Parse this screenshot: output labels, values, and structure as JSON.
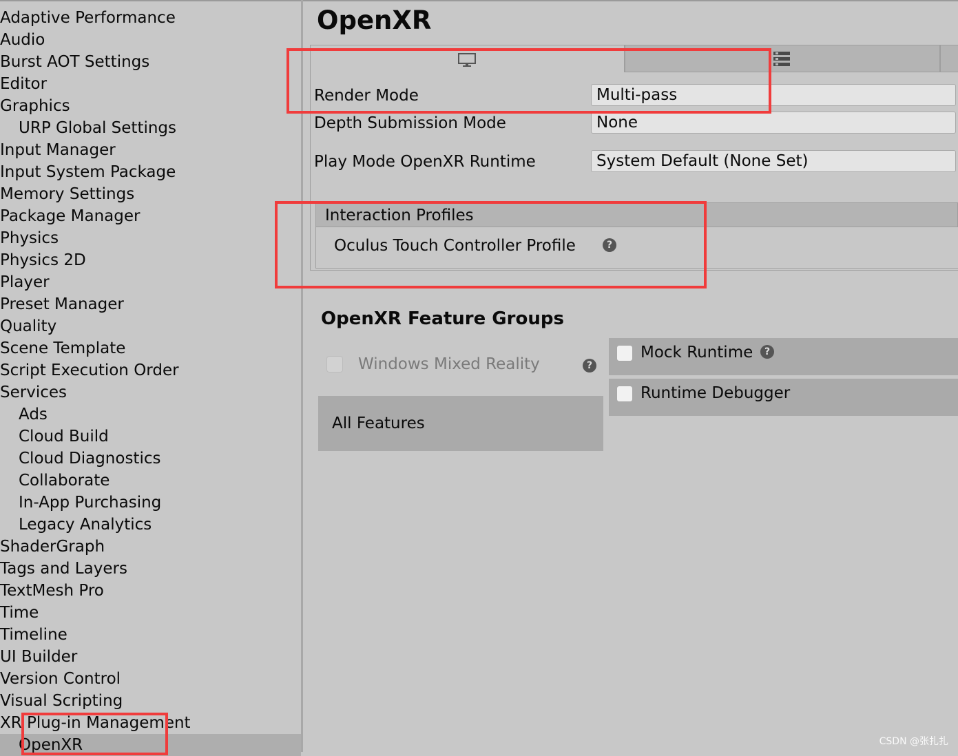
{
  "sidebar": {
    "items": [
      {
        "label": "Adaptive Performance"
      },
      {
        "label": "Audio"
      },
      {
        "label": "Burst AOT Settings"
      },
      {
        "label": "Editor"
      },
      {
        "label": "Graphics"
      },
      {
        "label": "URP Global Settings"
      },
      {
        "label": "Input Manager"
      },
      {
        "label": "Input System Package"
      },
      {
        "label": "Memory Settings"
      },
      {
        "label": "Package Manager"
      },
      {
        "label": "Physics"
      },
      {
        "label": "Physics 2D"
      },
      {
        "label": "Player"
      },
      {
        "label": "Preset Manager"
      },
      {
        "label": "Quality"
      },
      {
        "label": "Scene Template"
      },
      {
        "label": "Script Execution Order"
      },
      {
        "label": "Services"
      },
      {
        "label": "Ads"
      },
      {
        "label": "Cloud Build"
      },
      {
        "label": "Cloud Diagnostics"
      },
      {
        "label": "Collaborate"
      },
      {
        "label": "In-App Purchasing"
      },
      {
        "label": "Legacy Analytics"
      },
      {
        "label": "ShaderGraph"
      },
      {
        "label": "Tags and Layers"
      },
      {
        "label": "TextMesh Pro"
      },
      {
        "label": "Time"
      },
      {
        "label": "Timeline"
      },
      {
        "label": "UI Builder"
      },
      {
        "label": "Version Control"
      },
      {
        "label": "Visual Scripting"
      },
      {
        "label": "XR Plug-in Management"
      },
      {
        "label": "OpenXR",
        "selected": true
      }
    ]
  },
  "main": {
    "title": "OpenXR",
    "tabs": [
      {
        "icon": "monitor-icon",
        "active": true
      },
      {
        "icon": "android-icon",
        "active": false
      }
    ],
    "render_mode": {
      "label": "Render Mode",
      "value": "Multi-pass"
    },
    "depth_submission": {
      "label": "Depth Submission Mode",
      "value": "None"
    },
    "play_mode_runtime": {
      "label": "Play Mode OpenXR Runtime",
      "value": "System Default (None Set)"
    },
    "interaction_profiles": {
      "header": "Interaction Profiles",
      "items": [
        {
          "label": "Oculus Touch Controller Profile",
          "help": "?"
        }
      ]
    },
    "feature_groups": {
      "title": "OpenXR Feature Groups",
      "groups": [
        {
          "label": "Windows Mixed Reality",
          "checked": false,
          "enabled": false,
          "help": "?"
        }
      ],
      "all_features_label": "All Features",
      "features": [
        {
          "label": "Mock Runtime",
          "checked": false,
          "help": "?"
        },
        {
          "label": "Runtime Debugger",
          "checked": false
        }
      ]
    }
  },
  "watermark": "CSDN @张扎扎",
  "colors": {
    "highlight_box": "#f03c3c",
    "selected_row": "#aeaeae",
    "panel_bg": "#c8c8c8"
  }
}
